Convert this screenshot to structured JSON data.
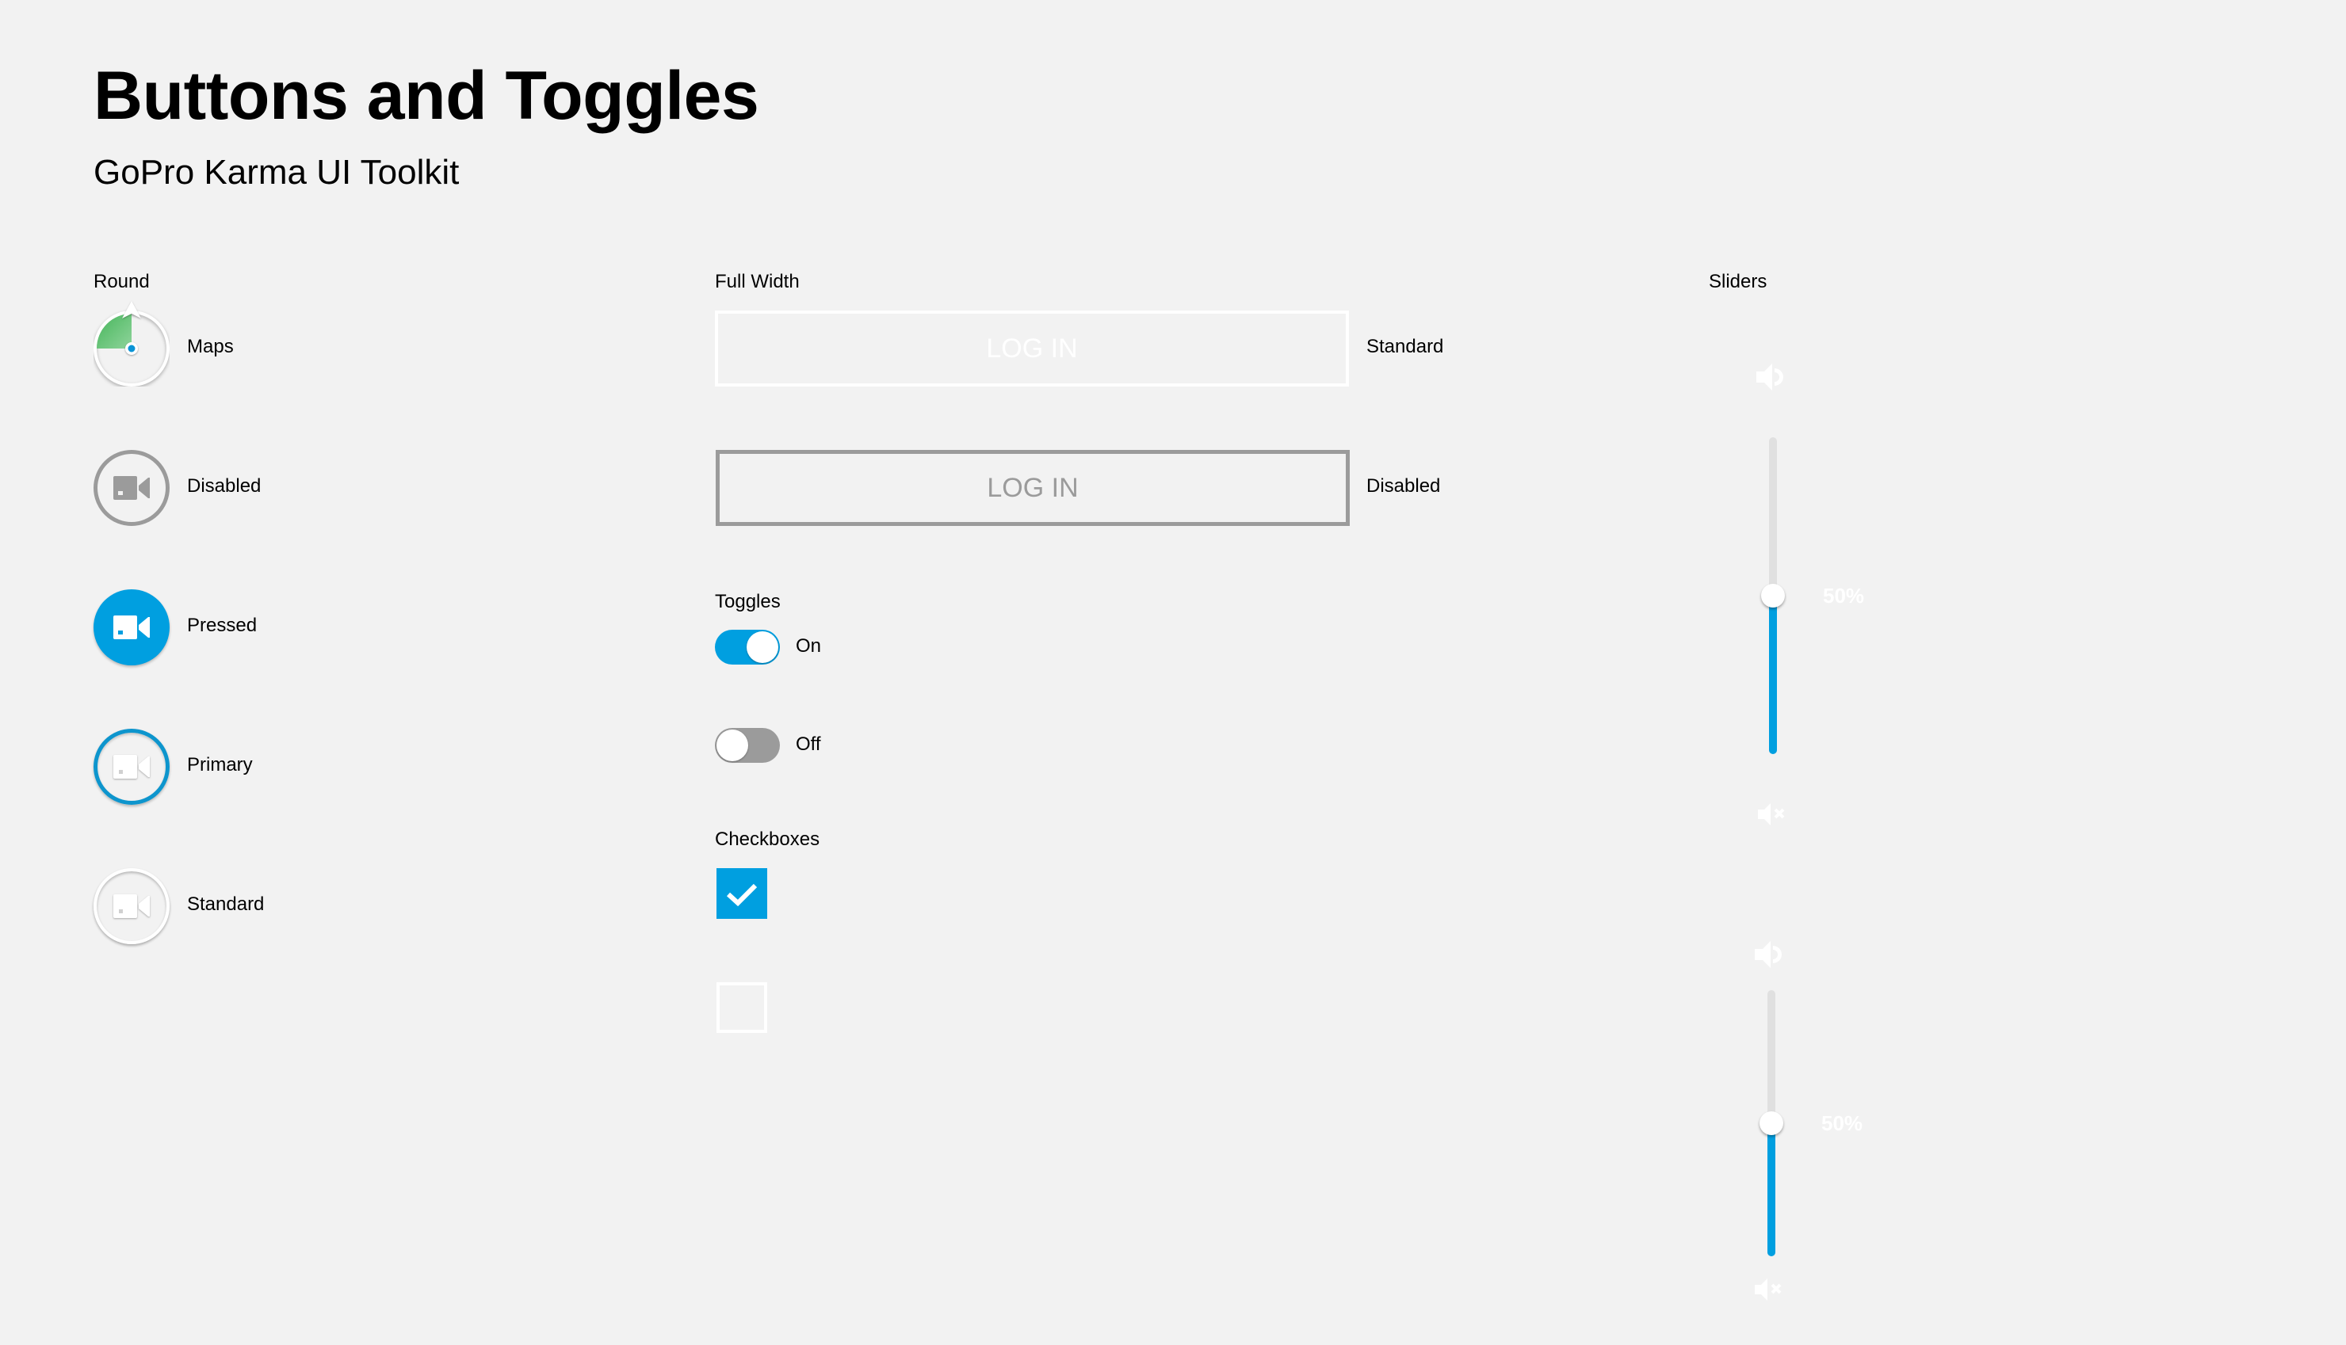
{
  "header": {
    "title": "Buttons and Toggles",
    "subtitle": "GoPro Karma UI Toolkit"
  },
  "round": {
    "section_label": "Round",
    "items": [
      {
        "label": "Maps",
        "icon": "map-compass-icon",
        "state": "maps"
      },
      {
        "label": "Disabled",
        "icon": "video-camera-icon",
        "state": "disabled"
      },
      {
        "label": "Pressed",
        "icon": "video-camera-icon",
        "state": "pressed"
      },
      {
        "label": "Primary",
        "icon": "video-camera-icon",
        "state": "primary"
      },
      {
        "label": "Standard",
        "icon": "video-camera-icon",
        "state": "standard"
      }
    ]
  },
  "full_width": {
    "section_label": "Full Width",
    "buttons": [
      {
        "text": "LOG IN",
        "label": "Standard",
        "state": "standard"
      },
      {
        "text": "LOG IN",
        "label": "Disabled",
        "state": "disabled"
      }
    ]
  },
  "toggles": {
    "section_label": "Toggles",
    "items": [
      {
        "label": "On",
        "checked": true
      },
      {
        "label": "Off",
        "checked": false
      }
    ]
  },
  "checkboxes": {
    "section_label": "Checkboxes",
    "items": [
      {
        "checked": true
      },
      {
        "checked": false
      }
    ]
  },
  "sliders": {
    "section_label": "Sliders",
    "items": [
      {
        "value_percent": 50,
        "value_label": "50%",
        "top_icon": "volume-up-icon",
        "bottom_icon": "volume-mute-icon"
      },
      {
        "value_percent": 50,
        "value_label": "50%",
        "top_icon": "volume-up-icon",
        "bottom_icon": "volume-mute-icon"
      }
    ]
  },
  "colors": {
    "background": "#f2f2f2",
    "accent": "#009fe0",
    "primary_ring": "#0d95cd",
    "disabled": "#9b9b9b",
    "maps_green": "#5cbf6e",
    "track": "#e0e0e0"
  }
}
